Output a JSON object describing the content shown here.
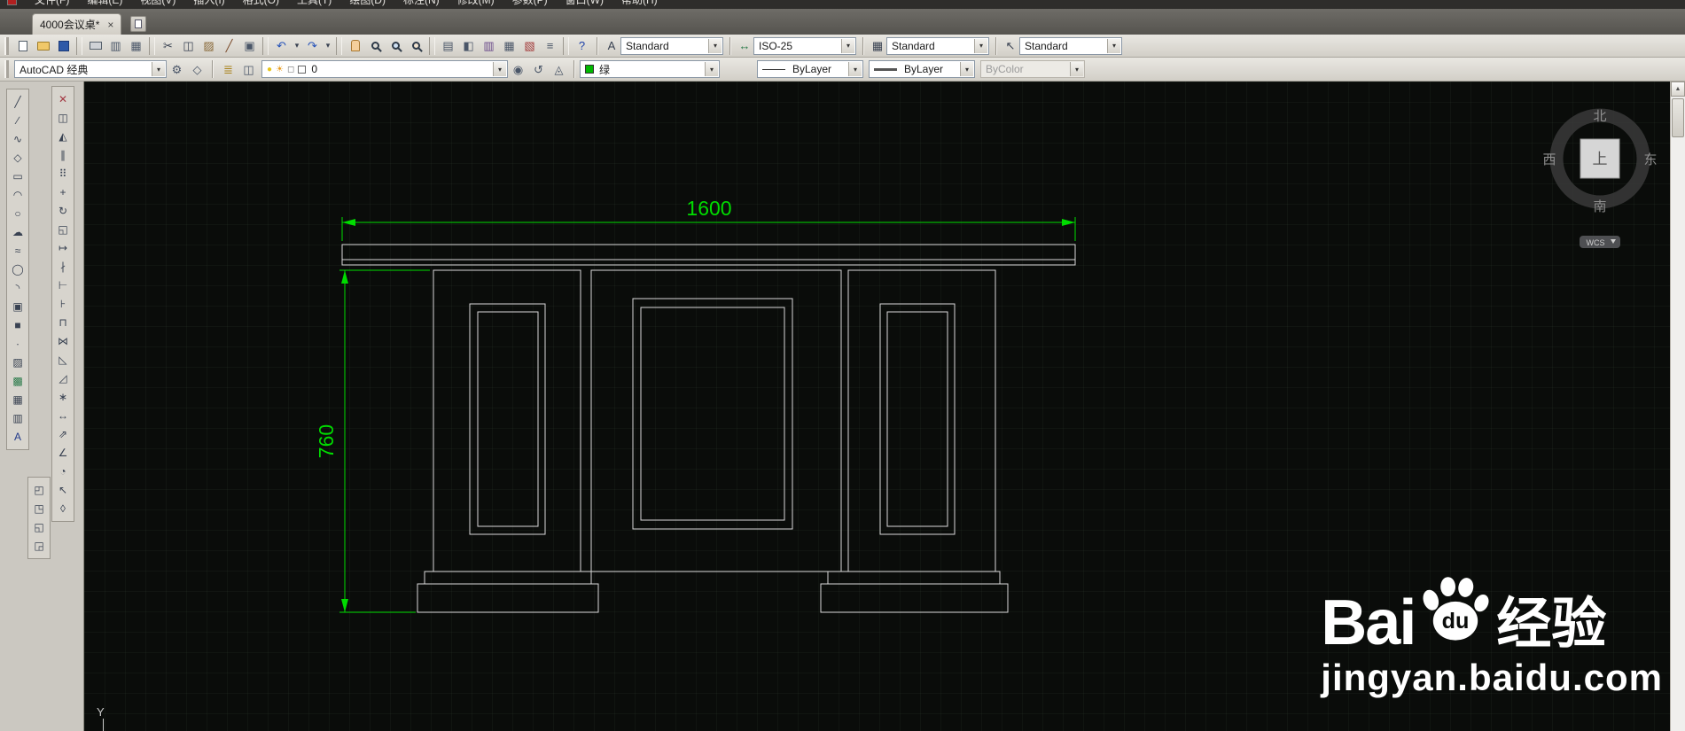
{
  "window": {
    "menu_items": [
      "文件(F)",
      "编辑(E)",
      "视图(V)",
      "插入(I)",
      "格式(O)",
      "工具(T)",
      "绘图(D)",
      "标注(N)",
      "修改(M)",
      "参数(P)",
      "窗口(W)",
      "帮助(H)"
    ]
  },
  "tabs": {
    "active_label": "4000会议桌*",
    "close_glyph": "×"
  },
  "ui": {
    "dropdown_arrow": "▾",
    "scroll_up": "▲"
  },
  "toolbar1": {
    "icons": [
      {
        "name": "new-button",
        "cls": "ic-page"
      },
      {
        "name": "open-button",
        "cls": "ic-folder"
      },
      {
        "name": "save-button",
        "cls": "ic-floppy"
      },
      {
        "sep": true
      },
      {
        "name": "plot-button",
        "cls": "ic-printer"
      },
      {
        "name": "plot-preview-button",
        "g": "▥",
        "c": "#4a5668"
      },
      {
        "name": "publish-button",
        "g": "▦",
        "c": "#4a5668"
      },
      {
        "sep": true
      },
      {
        "name": "cut-button",
        "g": "✂",
        "c": "#394252"
      },
      {
        "name": "copy-button",
        "g": "◫",
        "c": "#394252"
      },
      {
        "name": "paste-button",
        "g": "▨",
        "c": "#8a6a3a"
      },
      {
        "name": "match-properties-button",
        "g": "╱",
        "c": "#7a4a2a"
      },
      {
        "name": "block-editor-button",
        "g": "▣",
        "c": "#4a5668"
      },
      {
        "sep": true
      },
      {
        "name": "undo-button",
        "g": "↶",
        "c": "#2552b8"
      },
      {
        "name": "undo-dropdown",
        "g": "▾",
        "c": "#394252",
        "cls": "narrow"
      },
      {
        "name": "redo-button",
        "g": "↷",
        "c": "#2552b8"
      },
      {
        "name": "redo-dropdown",
        "g": "▾",
        "c": "#394252",
        "cls": "narrow"
      },
      {
        "sep": true
      },
      {
        "name": "pan-button",
        "cls": "ic-hand"
      },
      {
        "name": "zoom-realtime-button",
        "cls": "ic-zoom"
      },
      {
        "name": "zoom-window-button",
        "cls": "ic-zoomwin"
      },
      {
        "name": "zoom-previous-button",
        "cls": "ic-zoomprev"
      },
      {
        "sep": true
      },
      {
        "name": "properties-button",
        "g": "▤",
        "c": "#4a5668"
      },
      {
        "name": "designcenter-button",
        "g": "◧",
        "c": "#4a5668"
      },
      {
        "name": "tool-palettes-button",
        "g": "▥",
        "c": "#6a4a8a"
      },
      {
        "name": "sheet-set-manager-button",
        "g": "▦",
        "c": "#4a5668"
      },
      {
        "name": "markup-set-manager-button",
        "g": "▧",
        "c": "#a33a3a"
      },
      {
        "name": "quickcalc-button",
        "g": "≡",
        "c": "#4a5668"
      },
      {
        "sep": true
      },
      {
        "name": "help-button",
        "g": "?",
        "c": "#1a3fa8"
      }
    ],
    "styles": {
      "text": {
        "icon": "A",
        "value": "Standard"
      },
      "dim": {
        "icon": "↔",
        "value": "ISO-25"
      },
      "table": {
        "icon": "▦",
        "value": "Standard"
      },
      "mleader": {
        "icon": "↖",
        "value": "Standard"
      }
    }
  },
  "toolbar2": {
    "workspace": {
      "value": "AutoCAD 经典"
    },
    "ws_icons": [
      {
        "name": "workspace-settings-button",
        "g": "⚙",
        "c": "#4a5668"
      },
      {
        "name": "workspace-save-button",
        "g": "◇",
        "c": "#4a5668"
      }
    ],
    "layer_mgr_icons": [
      {
        "name": "layer-properties-button",
        "g": "≣",
        "c": "#a8821a"
      },
      {
        "name": "layer-states-button",
        "g": "◫",
        "c": "#4a5668"
      }
    ],
    "layer": {
      "bulb": "●",
      "sun": "☀",
      "lock": "◻",
      "swatch": "#ffffff",
      "value": "0"
    },
    "layer_tools": [
      {
        "name": "make-layer-current-button",
        "g": "◉",
        "c": "#4a5668"
      },
      {
        "name": "layer-previous-button",
        "g": "↺",
        "c": "#4a5668"
      },
      {
        "name": "layer-match-button",
        "g": "◬",
        "c": "#4a5668"
      }
    ],
    "color": {
      "value": "绿",
      "hex": "#00b800"
    },
    "linetype": {
      "value": "ByLayer"
    },
    "lineweight": {
      "value": "ByLayer"
    },
    "plotstyle": {
      "value": "ByColor"
    }
  },
  "palette": {
    "draw": [
      {
        "name": "line-tool",
        "g": "╱"
      },
      {
        "name": "construction-line-tool",
        "g": "∕"
      },
      {
        "name": "polyline-tool",
        "g": "∿"
      },
      {
        "name": "polygon-tool",
        "g": "◇"
      },
      {
        "name": "rectangle-tool",
        "g": "▭"
      },
      {
        "name": "arc-tool",
        "g": "◠"
      },
      {
        "name": "circle-tool",
        "g": "○"
      },
      {
        "name": "revision-cloud-tool",
        "g": "☁"
      },
      {
        "name": "spline-tool",
        "g": "≈"
      },
      {
        "name": "ellipse-tool",
        "g": "◯"
      },
      {
        "name": "ellipse-arc-tool",
        "g": "◝"
      },
      {
        "name": "insert-block-tool",
        "g": "▣"
      },
      {
        "name": "make-block-tool",
        "g": "■"
      },
      {
        "name": "point-tool",
        "g": "∙"
      },
      {
        "name": "hatch-tool",
        "g": "▨"
      },
      {
        "name": "gradient-tool",
        "g": "▩",
        "c": "#2a7a4a"
      },
      {
        "name": "region-tool",
        "g": "▦"
      },
      {
        "name": "table-tool",
        "g": "▥"
      },
      {
        "name": "multiline-text-tool",
        "g": "A",
        "c": "#223a8a"
      }
    ],
    "draworder": [
      {
        "name": "bring-to-front-tool",
        "g": "◰"
      },
      {
        "name": "bring-above-tool",
        "g": "◳"
      },
      {
        "name": "send-under-tool",
        "g": "◱"
      },
      {
        "name": "send-to-back-tool",
        "g": "◲"
      }
    ],
    "modify": [
      {
        "name": "erase-tool",
        "g": "✕",
        "c": "#a33a44"
      },
      {
        "name": "copy-tool",
        "g": "◫"
      },
      {
        "name": "mirror-tool",
        "g": "◭"
      },
      {
        "name": "offset-tool",
        "g": "∥"
      },
      {
        "name": "array-tool",
        "g": "⠿"
      },
      {
        "name": "move-tool",
        "g": "+"
      },
      {
        "name": "rotate-tool",
        "g": "↻"
      },
      {
        "name": "scale-tool",
        "g": "◱"
      },
      {
        "name": "stretch-tool",
        "g": "↦"
      },
      {
        "name": "trim-tool",
        "g": "∤"
      },
      {
        "name": "extend-tool",
        "g": "⊢"
      },
      {
        "name": "break-at-point-tool",
        "g": "⊦"
      },
      {
        "name": "break-tool",
        "g": "⊓"
      },
      {
        "name": "join-tool",
        "g": "⋈"
      },
      {
        "name": "chamfer-tool",
        "g": "◺"
      },
      {
        "name": "fillet-tool",
        "g": "◿"
      },
      {
        "name": "explode-tool",
        "g": "∗"
      },
      {
        "name": "dim-linear-tool",
        "g": "↔"
      },
      {
        "name": "dim-aligned-tool",
        "g": "⇗"
      },
      {
        "name": "dim-angular-tool",
        "g": "∠"
      },
      {
        "name": "dim-radius-tool",
        "g": "◔"
      },
      {
        "name": "quick-leader-tool",
        "g": "↖"
      },
      {
        "name": "dim-style-tool",
        "g": "◊"
      }
    ]
  },
  "canvas": {
    "dim_horizontal": "1600",
    "dim_vertical": "760",
    "compass": {
      "north": "北",
      "south": "南",
      "east": "东",
      "west": "西",
      "face": "上",
      "wcs": "WCS"
    },
    "ucs_y": "Y",
    "watermark": {
      "bai": "Bai",
      "du": "du",
      "brand": "经验",
      "url": "jingyan.baidu.com"
    }
  },
  "colors": {
    "dimension": "#00dc00",
    "lines": "#d9d9d9",
    "canvas_bg": "#0a0c0a",
    "swatch_green": "#00b800"
  }
}
